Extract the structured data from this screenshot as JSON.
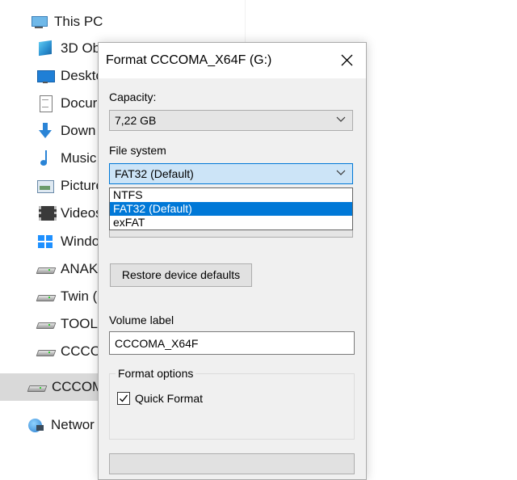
{
  "nav": {
    "items": [
      {
        "label": "This PC",
        "icon": "computer-icon"
      },
      {
        "label": "3D Ob",
        "icon": "3d-objects-icon"
      },
      {
        "label": "Deskto",
        "icon": "desktop-icon"
      },
      {
        "label": "Docur",
        "icon": "documents-icon"
      },
      {
        "label": "Down",
        "icon": "downloads-icon"
      },
      {
        "label": "Music",
        "icon": "music-icon"
      },
      {
        "label": "Picture",
        "icon": "pictures-icon"
      },
      {
        "label": "Videos",
        "icon": "videos-icon"
      },
      {
        "label": "Windo",
        "icon": "windows-drive-icon"
      },
      {
        "label": "ANAK",
        "icon": "drive-icon"
      },
      {
        "label": "Twin (",
        "icon": "drive-icon"
      },
      {
        "label": "TOOLS",
        "icon": "drive-icon"
      },
      {
        "label": "CCCOI",
        "icon": "drive-icon"
      },
      {
        "label": "CCCOM",
        "icon": "drive-icon"
      },
      {
        "label": "Networ",
        "icon": "network-icon"
      }
    ]
  },
  "dialog": {
    "title": "Format CCCOMA_X64F (G:)",
    "capacity": {
      "label": "Capacity:",
      "value": "7,22 GB"
    },
    "file_system": {
      "label": "File system",
      "value": "FAT32 (Default)",
      "options": [
        "NTFS",
        "FAT32 (Default)",
        "exFAT"
      ],
      "selected_option": "FAT32 (Default)"
    },
    "restore_label": "Restore device defaults",
    "volume_label": {
      "label": "Volume label",
      "value": "CCCOMA_X64F"
    },
    "format_options": {
      "title": "Format options",
      "quick_format_label": "Quick Format",
      "quick_format_checked": true
    }
  },
  "colors": {
    "accent": "#0078d7",
    "focus_fill": "#cce4f7",
    "dialog_bg": "#f0f0f0",
    "selected_nav": "#d9d9d9"
  }
}
